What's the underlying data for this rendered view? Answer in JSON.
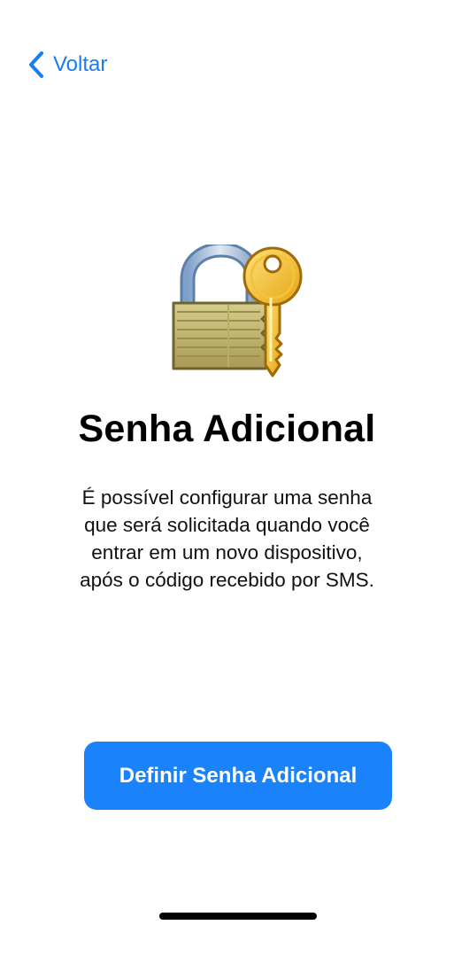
{
  "nav": {
    "back_icon": "chevron-left-icon",
    "back_label": "Voltar",
    "accent_color": "#1a7cf5"
  },
  "hero": {
    "icon": "lock-with-key-icon"
  },
  "main": {
    "title": "Senha Adicional",
    "description_lines": [
      "É possível configurar uma senha",
      "que será solicitada quando você",
      "entrar em um novo dispositivo,",
      "após o código recebido por SMS."
    ]
  },
  "actions": {
    "primary_label": "Definir Senha Adicional",
    "primary_color": "#1a82fb"
  }
}
